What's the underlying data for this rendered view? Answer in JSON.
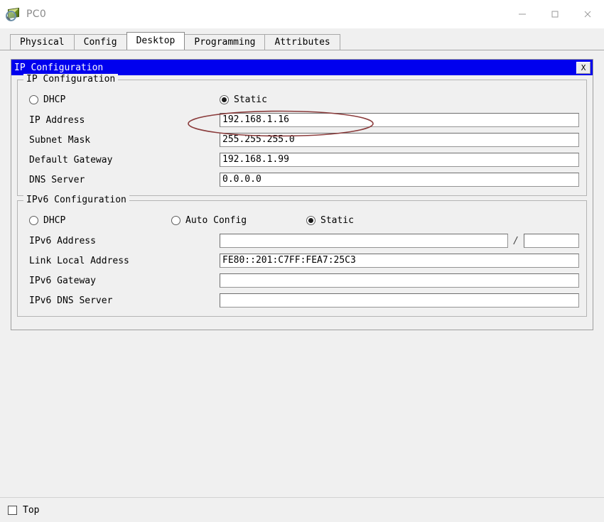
{
  "window": {
    "title": "PC0",
    "icon": "pc-device-icon",
    "controls": {
      "minimize": "minimize-icon",
      "maximize": "maximize-icon",
      "close": "close-icon"
    }
  },
  "tabs": [
    {
      "label": "Physical",
      "active": false
    },
    {
      "label": "Config",
      "active": false
    },
    {
      "label": "Desktop",
      "active": true
    },
    {
      "label": "Programming",
      "active": false
    },
    {
      "label": "Attributes",
      "active": false
    }
  ],
  "dialog": {
    "title": "IP Configuration",
    "close_label": "X",
    "ipv4": {
      "legend": "IP Configuration",
      "mode": {
        "dhcp_label": "DHCP",
        "dhcp_selected": false,
        "static_label": "Static",
        "static_selected": true
      },
      "fields": [
        {
          "label": "IP Address",
          "value": "192.168.1.16",
          "name": "ip-address"
        },
        {
          "label": "Subnet Mask",
          "value": "255.255.255.0",
          "name": "subnet-mask"
        },
        {
          "label": "Default Gateway",
          "value": "192.168.1.99",
          "name": "default-gateway"
        },
        {
          "label": "DNS Server",
          "value": "0.0.0.0",
          "name": "dns-server"
        }
      ]
    },
    "ipv6": {
      "legend": "IPv6 Configuration",
      "mode": {
        "dhcp_label": "DHCP",
        "dhcp_selected": false,
        "auto_label": "Auto Config",
        "auto_selected": false,
        "static_label": "Static",
        "static_selected": true
      },
      "address_label": "IPv6 Address",
      "address_value": "",
      "prefix_separator": "/",
      "prefix_value": "",
      "link_local_label": "Link Local Address",
      "link_local_value": "FE80::201:C7FF:FEA7:25C3",
      "gateway_label": "IPv6 Gateway",
      "gateway_value": "",
      "dns_label": "IPv6 DNS Server",
      "dns_value": ""
    }
  },
  "bottom": {
    "top_label": "Top",
    "top_checked": false
  },
  "colors": {
    "dialog_titlebar": "#0000ee",
    "annotation": "#8a3b3b",
    "window_bg": "#f0f0f0",
    "field_bg": "#ffffff"
  }
}
